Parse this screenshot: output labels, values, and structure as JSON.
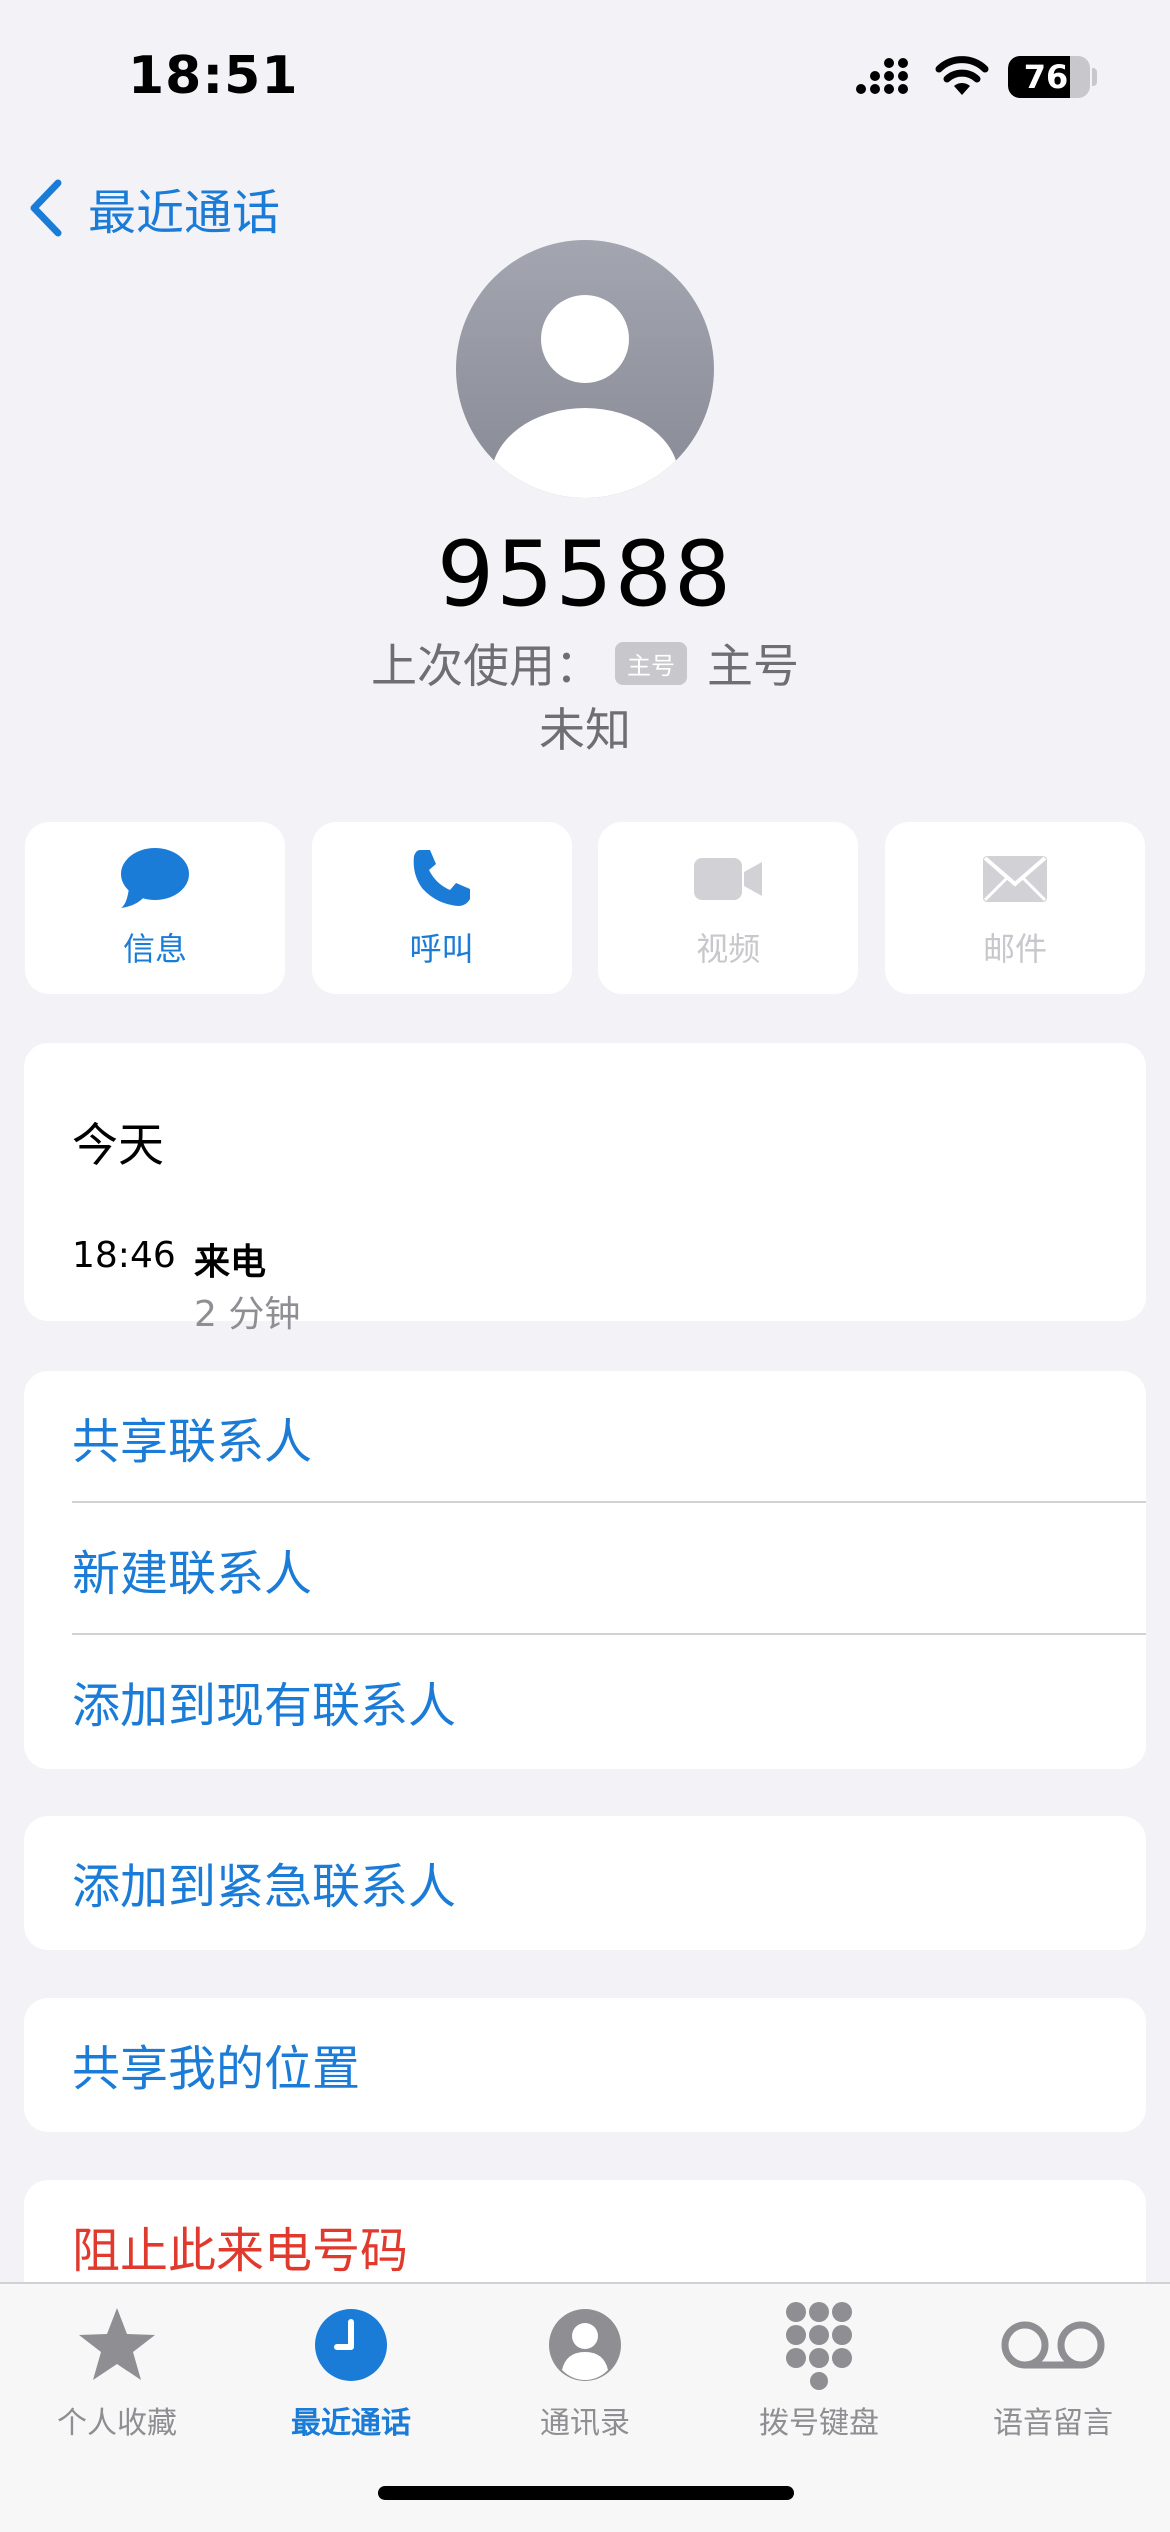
{
  "status_bar": {
    "time": "18:51",
    "battery_level": "76",
    "battery_fraction": 0.76
  },
  "nav": {
    "back_label": "最近通话"
  },
  "contact": {
    "number": "95588",
    "last_used_label": "上次使用：",
    "sim_badge": "主号",
    "sim_name": "主号",
    "location": "未知"
  },
  "actions": [
    {
      "label": "信息",
      "icon": "message-bubble-icon",
      "enabled": true
    },
    {
      "label": "呼叫",
      "icon": "phone-icon",
      "enabled": true
    },
    {
      "label": "视频",
      "icon": "video-camera-icon",
      "enabled": false
    },
    {
      "label": "邮件",
      "icon": "mail-envelope-icon",
      "enabled": false
    }
  ],
  "history": {
    "date": "今天",
    "time": "18:46",
    "type": "来电",
    "duration": "2 分钟"
  },
  "contact_options": [
    {
      "label": "共享联系人"
    },
    {
      "label": "新建联系人"
    },
    {
      "label": "添加到现有联系人"
    }
  ],
  "emergency": {
    "label": "添加到紧急联系人"
  },
  "location_share": {
    "label": "共享我的位置"
  },
  "block": {
    "label": "阻止此来电号码"
  },
  "tabs": [
    {
      "label": "个人收藏",
      "icon": "star-icon",
      "active": false
    },
    {
      "label": "最近通话",
      "icon": "clock-icon",
      "active": true
    },
    {
      "label": "通讯录",
      "icon": "contacts-person-icon",
      "active": false
    },
    {
      "label": "拨号键盘",
      "icon": "keypad-icon",
      "active": false
    },
    {
      "label": "语音留言",
      "icon": "voicemail-icon",
      "active": false
    }
  ],
  "colors": {
    "accent": "#1b7cd8",
    "danger": "#e0392e",
    "disabled": "#c7c7cc",
    "background": "#f2f2f7"
  }
}
